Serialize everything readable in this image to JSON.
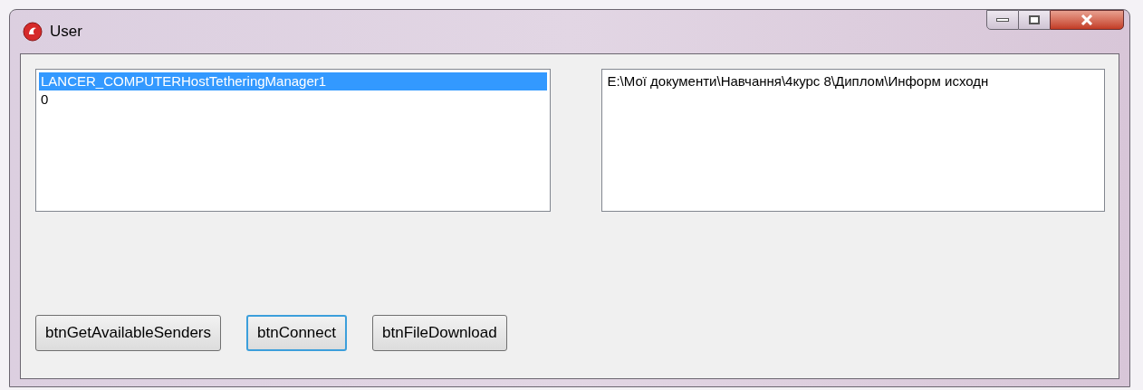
{
  "window": {
    "title": "User"
  },
  "senders_list": {
    "items": [
      {
        "text": "LANCER_COMPUTERHostTetheringManager1",
        "selected": true
      },
      {
        "text": "0",
        "selected": false
      }
    ]
  },
  "path_list": {
    "items": [
      {
        "text": "E:\\Мої документи\\Навчання\\4курс 8\\Диплом\\Информ исходн",
        "selected": false
      }
    ]
  },
  "buttons": [
    {
      "label": "btnGetAvailableSenders",
      "focused": false
    },
    {
      "label": "btnConnect",
      "focused": true
    },
    {
      "label": "btnFileDownload",
      "focused": false
    }
  ]
}
